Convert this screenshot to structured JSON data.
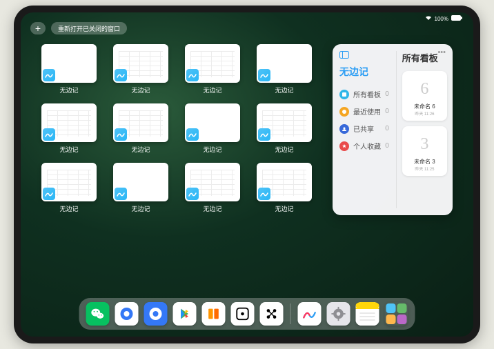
{
  "statusbar": {
    "wifi": "wifi-icon",
    "battery": "100%"
  },
  "topbar": {
    "plus": "+",
    "reopen_label": "重新打开已关闭的窗口"
  },
  "windows": [
    {
      "label": "无边记",
      "content": false
    },
    {
      "label": "无边记",
      "content": true
    },
    {
      "label": "无边记",
      "content": true
    },
    {
      "label": "无边记",
      "content": false
    },
    {
      "label": "无边记",
      "content": true
    },
    {
      "label": "无边记",
      "content": true
    },
    {
      "label": "无边记",
      "content": false
    },
    {
      "label": "无边记",
      "content": true
    },
    {
      "label": "无边记",
      "content": true
    },
    {
      "label": "无边记",
      "content": false
    },
    {
      "label": "无边记",
      "content": true
    },
    {
      "label": "无边记",
      "content": true
    }
  ],
  "panel": {
    "left_title": "无边记",
    "right_title": "所有看板",
    "categories": [
      {
        "label": "所有看板",
        "count": 0,
        "color": "#2fb6e8"
      },
      {
        "label": "最近使用",
        "count": 0,
        "color": "#f5a623"
      },
      {
        "label": "已共享",
        "count": 0,
        "color": "#3869d9"
      },
      {
        "label": "个人收藏",
        "count": 0,
        "color": "#e94b4b"
      }
    ],
    "boards": [
      {
        "sketch": "6",
        "name": "未命名 6",
        "sub": "昨天 11:26"
      },
      {
        "sketch": "3",
        "name": "未命名 3",
        "sub": "昨天 11:25"
      }
    ]
  },
  "dock": [
    {
      "name": "wechat",
      "bg": "#07c160",
      "glyph": "wechat"
    },
    {
      "name": "quark-hd",
      "bg": "#ffffff",
      "glyph": "quark-blue"
    },
    {
      "name": "quark",
      "bg": "#3478f6",
      "glyph": "quark-white"
    },
    {
      "name": "play",
      "bg": "#ffffff",
      "glyph": "play"
    },
    {
      "name": "books",
      "bg": "#ffffff",
      "glyph": "books"
    },
    {
      "name": "dice",
      "bg": "#ffffff",
      "glyph": "dice"
    },
    {
      "name": "dots",
      "bg": "#ffffff",
      "glyph": "dots"
    }
  ],
  "dock_recent": [
    {
      "name": "freeform",
      "bg": "#ffffff",
      "glyph": "freeform"
    },
    {
      "name": "settings",
      "bg": "#e5e5ea",
      "glyph": "gear"
    },
    {
      "name": "notes",
      "bg": "#ffffff",
      "glyph": "notes"
    },
    {
      "name": "app-library",
      "bg": "transparent",
      "glyph": "library"
    }
  ]
}
